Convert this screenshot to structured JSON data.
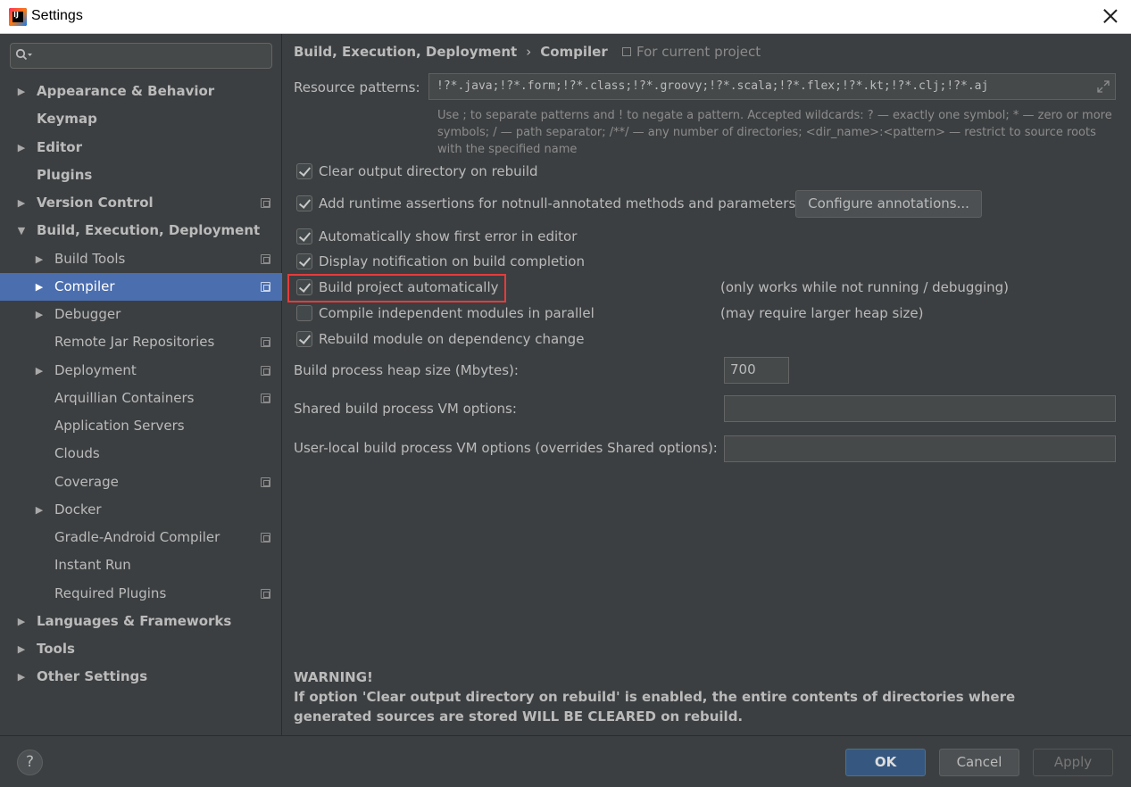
{
  "window": {
    "title": "Settings"
  },
  "sidebar": {
    "search_value": "",
    "items": [
      {
        "label": "Appearance & Behavior",
        "arrow": "▶"
      },
      {
        "label": "Keymap",
        "arrow": ""
      },
      {
        "label": "Editor",
        "arrow": "▶"
      },
      {
        "label": "Plugins",
        "arrow": ""
      },
      {
        "label": "Version Control",
        "arrow": "▶"
      },
      {
        "label": "Build, Execution, Deployment",
        "arrow": "▼"
      },
      {
        "label": "Build Tools",
        "arrow": "▶"
      },
      {
        "label": "Compiler",
        "arrow": "▶"
      },
      {
        "label": "Debugger",
        "arrow": "▶"
      },
      {
        "label": "Remote Jar Repositories",
        "arrow": ""
      },
      {
        "label": "Deployment",
        "arrow": "▶"
      },
      {
        "label": "Arquillian Containers",
        "arrow": ""
      },
      {
        "label": "Application Servers",
        "arrow": ""
      },
      {
        "label": "Clouds",
        "arrow": ""
      },
      {
        "label": "Coverage",
        "arrow": ""
      },
      {
        "label": "Docker",
        "arrow": "▶"
      },
      {
        "label": "Gradle-Android Compiler",
        "arrow": ""
      },
      {
        "label": "Instant Run",
        "arrow": ""
      },
      {
        "label": "Required Plugins",
        "arrow": ""
      },
      {
        "label": "Languages & Frameworks",
        "arrow": "▶"
      },
      {
        "label": "Tools",
        "arrow": "▶"
      },
      {
        "label": "Other Settings",
        "arrow": "▶"
      }
    ]
  },
  "main": {
    "breadcrumb": {
      "parent": "Build, Execution, Deployment",
      "separator": "›",
      "current": "Compiler"
    },
    "scope_label": "For current project",
    "resource_patterns": {
      "label": "Resource patterns:",
      "value": "!?*.java;!?*.form;!?*.class;!?*.groovy;!?*.scala;!?*.flex;!?*.kt;!?*.clj;!?*.aj",
      "hint": "Use ; to separate patterns and ! to negate a pattern. Accepted wildcards: ? — exactly one symbol; * — zero or more symbols; / — path separator; /**/ — any number of directories; <dir_name>:<pattern> — restrict to source roots with the specified name"
    },
    "options": [
      {
        "label": "Clear output directory on rebuild",
        "checked": true
      },
      {
        "label": "Add runtime assertions for notnull-annotated methods and parameters",
        "checked": true
      },
      {
        "label": "Automatically show first error in editor",
        "checked": true
      },
      {
        "label": "Display notification on build completion",
        "checked": true
      },
      {
        "label": "Build project automatically",
        "checked": true,
        "note": "(only works while not running / debugging)"
      },
      {
        "label": "Compile independent modules in parallel",
        "checked": false,
        "note": "(may require larger heap size)"
      },
      {
        "label": "Rebuild module on dependency change",
        "checked": true
      }
    ],
    "configure_annotations_label": "Configure annotations...",
    "heap_size": {
      "label": "Build process heap size (Mbytes):",
      "value": "700"
    },
    "shared_vm": {
      "label": "Shared build process VM options:",
      "value": ""
    },
    "user_vm": {
      "label": "User-local build process VM options (overrides Shared options):",
      "value": ""
    },
    "warning": {
      "title": "WARNING!",
      "text": "If option 'Clear output directory on rebuild' is enabled, the entire contents of directories where generated sources are stored WILL BE CLEARED on rebuild."
    }
  },
  "footer": {
    "help": "?",
    "ok": "OK",
    "cancel": "Cancel",
    "apply": "Apply"
  },
  "colors": {
    "background": "#3c3f41",
    "selection": "#4b6eaf",
    "highlight_border": "#e53b3b",
    "ok_button": "#365880"
  }
}
